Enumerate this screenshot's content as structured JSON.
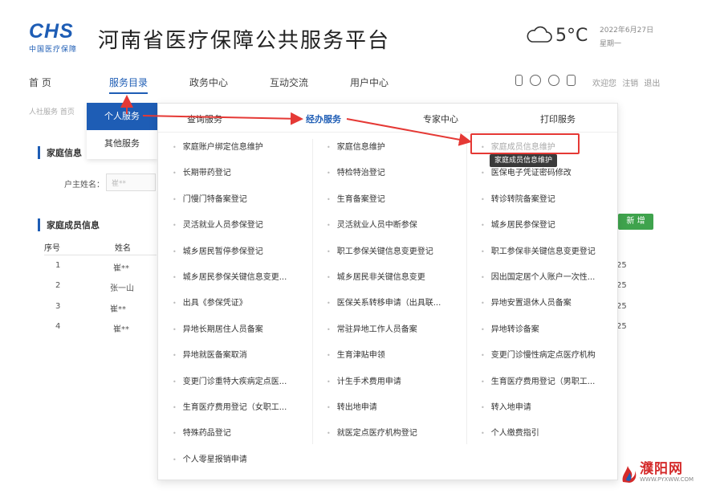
{
  "header": {
    "logo_mark": "CHS",
    "logo_sub": "中国医疗保障",
    "site_title": "河南省医疗保障公共服务平台",
    "temperature": "5°C",
    "date": "2022年6月27日",
    "weekday": "星期一"
  },
  "nav": {
    "items": [
      "首 页",
      "服务目录",
      "政务中心",
      "互动交流",
      "用户中心"
    ],
    "active": "服务目录",
    "links": [
      "欢迎您",
      "注销",
      "退出"
    ]
  },
  "crumb": "人社服务  首页",
  "page": {
    "family_info_title": "家庭信息",
    "owner_label": "户主姓名：",
    "owner_value": "崔**",
    "members_title": "家庭成员信息",
    "add_button": "新 增",
    "table_headers": [
      "序号",
      "姓名"
    ],
    "rows": [
      {
        "no": "1",
        "name": "崔**"
      },
      {
        "no": "2",
        "name": "张一山"
      },
      {
        "no": "3",
        "name": "崔**"
      },
      {
        "no": "4",
        "name": "崔**"
      }
    ],
    "right_values": [
      "25",
      "25",
      "25",
      "25"
    ]
  },
  "left_tabs": [
    "个人服务",
    "其他服务"
  ],
  "mega": {
    "categories": [
      "查询服务",
      "经办服务",
      "专家中心",
      "打印服务"
    ],
    "active_category": "经办服务",
    "col1": [
      "家庭账户绑定信息维护",
      "长期带药登记",
      "门慢门特备案登记",
      "灵活就业人员参保登记",
      "城乡居民暂停参保登记",
      "城乡居民参保关键信息变更...",
      "出具《参保凭证》",
      "异地长期居住人员备案",
      "异地就医备案取消",
      "变更门诊重特大疾病定点医...",
      "生育医疗费用登记（女职工...",
      "特殊药品登记",
      "个人零星报销申请"
    ],
    "col2": [
      "家庭信息维护",
      "特检特治登记",
      "生育备案登记",
      "灵活就业人员中断参保",
      "职工参保关键信息变更登记",
      "城乡居民非关键信息变更",
      "医保关系转移申请（出具联...",
      "常驻异地工作人员备案",
      "生育津贴申领",
      "计生手术费用申请",
      "转出地申请",
      "就医定点医疗机构登记"
    ],
    "col3": [
      "家庭成员信息维护",
      "医保电子凭证密码修改",
      "转诊转院备案登记",
      "城乡居民参保登记",
      "职工参保非关键信息变更登记",
      "因出国定居个人账户一次性...",
      "异地安置退休人员备案",
      "异地转诊备案",
      "变更门诊慢性病定点医疗机构",
      "生育医疗费用登记（男职工...",
      "转入地申请",
      "个人缴费指引"
    ],
    "tooltip": "家庭成员信息维护"
  },
  "watermark": {
    "name": "濮阳网",
    "url": "WWW.PYXWW.COM"
  }
}
